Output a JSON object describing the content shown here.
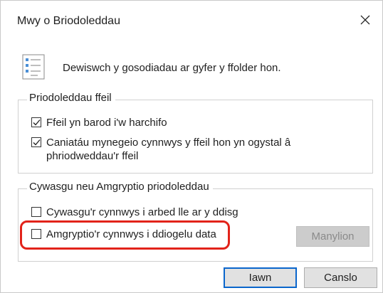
{
  "window": {
    "title": "Mwy o Briodoleddau"
  },
  "intro": {
    "text": "Dewiswch y gosodiadau ar gyfer y ffolder hon.",
    "icon": "settings-list-icon"
  },
  "file_attributes": {
    "label": "Priodoleddau ffeil",
    "items": [
      {
        "label": "Ffeil yn barod i'w harchifo",
        "checked": true
      },
      {
        "label": "Caniatáu mynegeio cynnwys y ffeil hon yn ogystal â",
        "label_line2": "phriodweddau'r ffeil",
        "checked": true
      }
    ]
  },
  "compress_encrypt": {
    "label": "Cywasgu neu Amgryptio priodoleddau",
    "items": [
      {
        "label": "Cywasgu'r cynnwys i arbed lle ar y ddisg",
        "checked": false
      },
      {
        "label": "Amgryptio'r cynnwys i ddiogelu data",
        "checked": false,
        "highlighted": true
      }
    ],
    "details_button": "Manylion"
  },
  "buttons": {
    "ok": "Iawn",
    "cancel": "Canslo"
  },
  "colors": {
    "highlight": "#e2231a",
    "default_button_border": "#0a66cc"
  }
}
